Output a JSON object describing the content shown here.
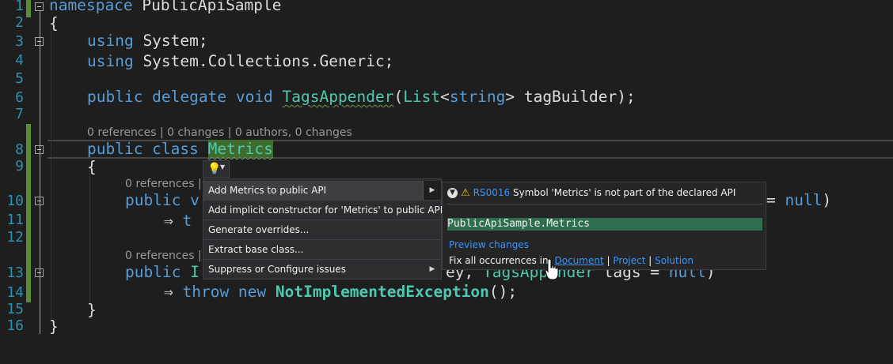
{
  "editor": {
    "line_numbers": [
      "1",
      "2",
      "3",
      "4",
      "5",
      "6",
      "7",
      "8",
      "9",
      "10",
      "11",
      "12",
      "13",
      "14",
      "15",
      "16"
    ],
    "codelens": {
      "class_lens": "0 references | 0 changes | 0 authors, 0 changes",
      "member_lens_1": "0 references |",
      "member_lens_2": "0 references |"
    },
    "code": {
      "l1_kw": "namespace",
      "l1_name": " PublicApiSample",
      "l2": "{",
      "l3_kw": "using",
      "l3_rest": " System;",
      "l4_kw": "using",
      "l4_rest": " System.Collections.Generic;",
      "l6_kw": "public delegate void ",
      "l6_type": "TagsAppender",
      "l6_paren": "(",
      "l6_list": "List",
      "l6_lt": "<",
      "l6_string": "string",
      "l6_rest": "> tagBuilder);",
      "l8_kw": "public class ",
      "l8_name": "Metrics",
      "l9": "{",
      "l10_kw": "public v",
      "l10_tail_kw": "null",
      "l10_tail_rest": ")",
      "l10_tail_eq": "= ",
      "l11_arrow": "⇒ ",
      "l11_t": "t",
      "l13_kw": "public ",
      "l13_I": "I",
      "l13_mid": "ey, ",
      "l13_type": "TagsAppender",
      "l13_rest": " tags = ",
      "l13_null": "null",
      "l13_close": ")",
      "l14_arrow": "⇒ ",
      "l14_kw": "throw new ",
      "l14_ex": "NotImplementedException",
      "l14_rest": "();",
      "l15": "}",
      "l16": "}"
    }
  },
  "quick_actions": {
    "items": [
      {
        "label": "Add Metrics to public API",
        "submenu": true
      },
      {
        "label": "Add implicit constructor for 'Metrics' to public API",
        "submenu": false
      },
      {
        "label": "Generate overrides...",
        "submenu": false
      },
      {
        "label": "Extract base class...",
        "submenu": false
      },
      {
        "label": "Suppress or Configure issues",
        "submenu": true
      }
    ],
    "submenu_arrow": "▶"
  },
  "preview": {
    "rule_id": "RS0016",
    "message": "Symbol 'Metrics' is not part of the declared API",
    "diff_line": "PublicApiSample.Metrics",
    "preview_link": "Preview changes",
    "fix_all_label": "Fix all occurrences in:",
    "scope_document": "Document",
    "scope_project": "Project",
    "scope_solution": "Solution",
    "sep": "|"
  },
  "colors": {
    "background": "#1e1e1e",
    "keyword": "#569cd6",
    "type": "#4ec9b0",
    "line_number": "#2b91af",
    "change_bar": "#5f8a3a",
    "link": "#3794ff",
    "diff_added": "#2f6f4f"
  },
  "icons": [
    "lightbulb-icon",
    "dropdown-arrow-icon",
    "warning-icon",
    "collapse-toggle-icon",
    "hand-cursor-icon",
    "fold-minus-icon",
    "submenu-arrow-icon"
  ]
}
